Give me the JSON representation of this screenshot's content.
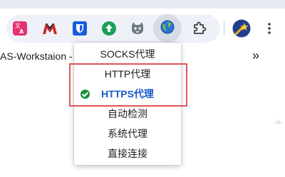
{
  "toolbar": {
    "extensions": [
      {
        "name": "translate-extension-icon",
        "color": "#e5326e"
      },
      {
        "name": "mega-extension-icon",
        "color": "#c82a2a"
      },
      {
        "name": "bitwarden-extension-icon",
        "color": "#175ddc"
      },
      {
        "name": "upload-extension-icon",
        "color": "#19a052"
      },
      {
        "name": "cat-extension-icon",
        "color": "#5d6b73"
      },
      {
        "name": "proxy-globe-extension-icon",
        "color": "#2b6fd6"
      },
      {
        "name": "puzzle-extensions-icon",
        "color": "#3c4043"
      }
    ],
    "profile_icon": "shooting-star-avatar-icon",
    "menu_icon": "more-vert-icon"
  },
  "bookmarks": {
    "item_text": "AS-Workstaion -",
    "overflow_label": "»"
  },
  "proxy_menu": {
    "items": [
      {
        "label": "SOCKS代理",
        "active": false
      },
      {
        "label": "HTTP代理",
        "active": false
      },
      {
        "label": "HTTPS代理",
        "active": true
      },
      {
        "label": "自动检测",
        "active": false
      },
      {
        "label": "系统代理",
        "active": false
      },
      {
        "label": "直接连接",
        "active": false
      }
    ],
    "highlight_color": "#e05555",
    "active_color": "#1a5ac8",
    "check_color": "#1e8e3e"
  }
}
